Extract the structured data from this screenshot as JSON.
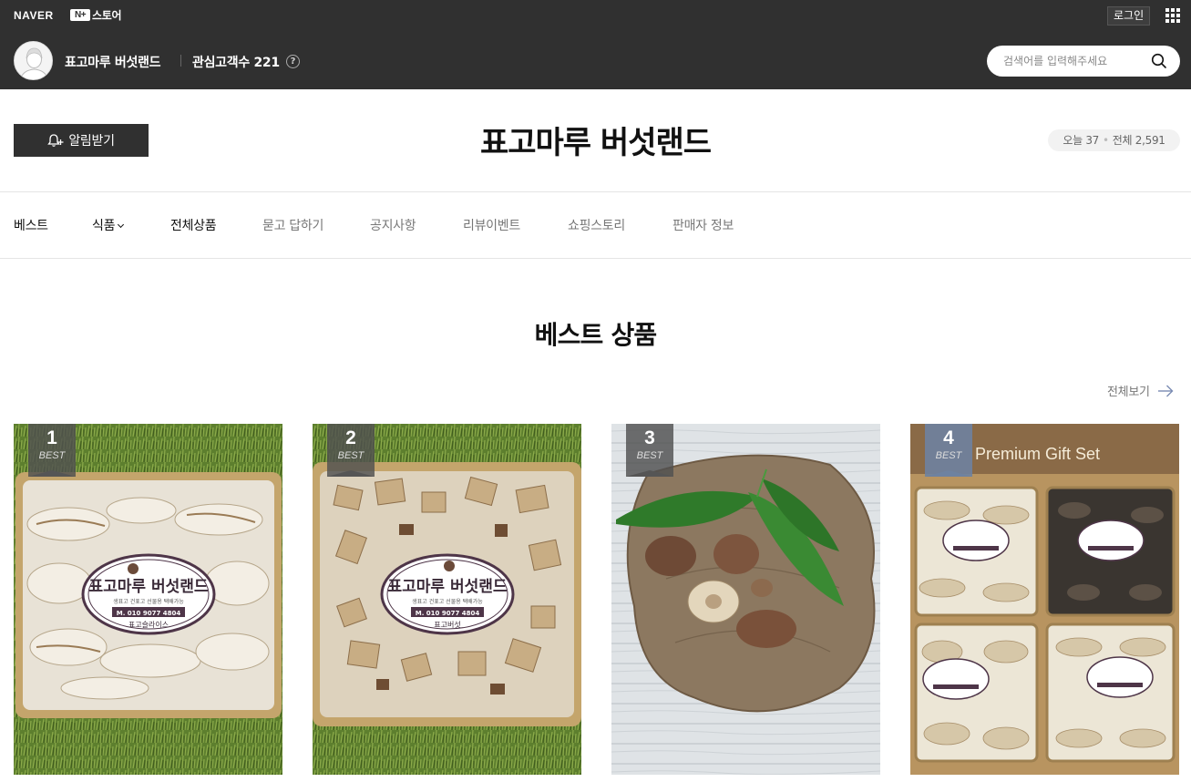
{
  "gnb": {
    "naver": "NAVER",
    "nplus": "N+",
    "store": "스토어",
    "login": "로그인"
  },
  "store_bar": {
    "name": "표고마루 버섯랜드",
    "interest_label": "관심고객수 221",
    "help": "?",
    "search_placeholder": "검색어를 입력해주세요"
  },
  "header": {
    "notify": "알림받기",
    "title": "표고마루 버섯랜드",
    "visitor_today": "오늘 37",
    "visitor_sep": "•",
    "visitor_total": "전체 2,591"
  },
  "nav": {
    "items": [
      {
        "label": "베스트"
      },
      {
        "label": "식품"
      },
      {
        "label": "전체상품"
      },
      {
        "label": "묻고 답하기"
      },
      {
        "label": "공지사항"
      },
      {
        "label": "리뷰이벤트"
      },
      {
        "label": "쇼핑스토리"
      },
      {
        "label": "판매자 정보"
      }
    ]
  },
  "best": {
    "title": "베스트 상품",
    "view_all": "전체보기",
    "products": [
      {
        "rank": "1",
        "badge": "BEST",
        "label_name": "표고마루 버섯랜드",
        "label_sub": "생표고 건표고 선물용 택배가능",
        "label_phone": "M. 010 9077 4804",
        "label_kind": "표고슬라이스"
      },
      {
        "rank": "2",
        "badge": "BEST",
        "label_name": "표고마루 버섯랜드",
        "label_sub": "생표고 건표고 선물용 택배가능",
        "label_phone": "M. 010 9077 4804",
        "label_kind": "표고버섯"
      },
      {
        "rank": "3",
        "badge": "BEST"
      },
      {
        "rank": "4",
        "badge": "BEST",
        "gift_text": "Premium Gift Set"
      }
    ]
  },
  "colors": {
    "topbar": "#303030",
    "accent_badge_blue": "#6e82a0"
  }
}
